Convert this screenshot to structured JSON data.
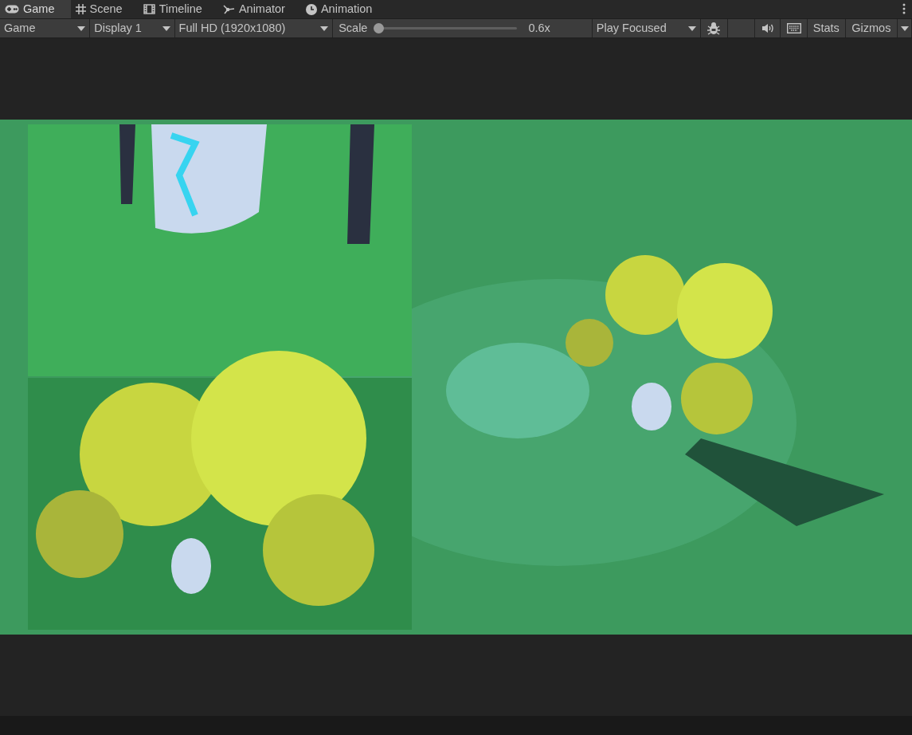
{
  "tabs": [
    {
      "label": "Game",
      "selected": true
    },
    {
      "label": "Scene",
      "selected": false
    },
    {
      "label": "Timeline",
      "selected": false
    },
    {
      "label": "Animator",
      "selected": false
    },
    {
      "label": "Animation",
      "selected": false
    }
  ],
  "toolbar": {
    "view_dropdown": "Game",
    "display_dropdown": "Display 1",
    "resolution_dropdown": "Full HD (1920x1080)",
    "scale": {
      "label": "Scale",
      "level": 0,
      "reading": "0.6x"
    },
    "play_mode_dropdown": "Play Focused",
    "stats": "Stats",
    "gizmos": "Gizmos"
  }
}
